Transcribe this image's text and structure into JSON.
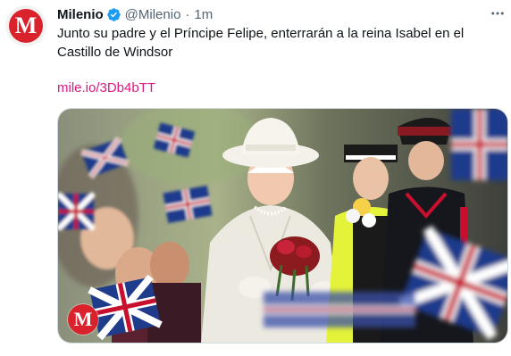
{
  "tweet": {
    "author": {
      "display_name": "Milenio",
      "handle": "@Milenio",
      "avatar_letter": "M",
      "avatar_color": "#d9222b",
      "verified_icon": "verified-badge-icon"
    },
    "separator": "·",
    "time": "1m",
    "text": "Junto su padre y el Príncipe Felipe, enterrarán a la reina Isabel en el Castillo de Windsor",
    "link": "mile.io/3Db4bTT",
    "link_color": "#d9197f",
    "media": {
      "logo_letter": "M"
    },
    "more_icon": "more-dots-icon"
  }
}
